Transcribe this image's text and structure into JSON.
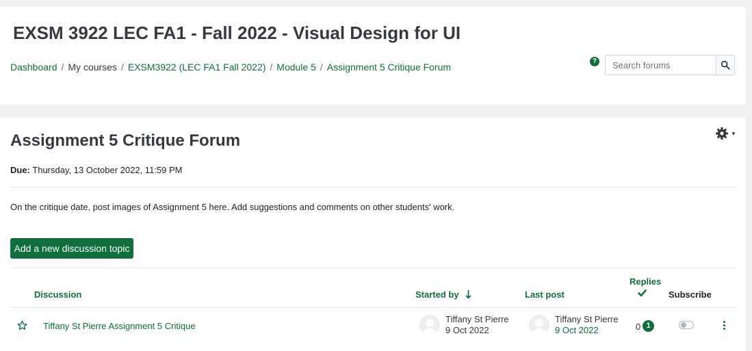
{
  "header": {
    "course_title": "EXSM 3922 LEC FA1 - Fall 2022 - Visual Design for UI",
    "breadcrumb": [
      {
        "label": "Dashboard",
        "link": true
      },
      {
        "label": "My courses",
        "link": false
      },
      {
        "label": "EXSM3922 (LEC FA1 Fall 2022)",
        "link": true
      },
      {
        "label": "Module 5",
        "link": true
      },
      {
        "label": "Assignment 5 Critique Forum",
        "link": true
      }
    ],
    "help_icon": "question-circle-icon",
    "search": {
      "placeholder": "Search forums",
      "value": ""
    }
  },
  "forum": {
    "title": "Assignment 5 Critique Forum",
    "due_label": "Due:",
    "due_value": "Thursday, 13 October 2022, 11:59 PM",
    "intro": "On the critique date, post images of Assignment 5 here. Add suggestions and comments on other students' work.",
    "add_topic_label": "Add a new discussion topic",
    "settings_icon": "gear-icon"
  },
  "table": {
    "columns": {
      "discussion": "Discussion",
      "started_by": "Started by",
      "last_post": "Last post",
      "replies": "Replies",
      "subscribe": "Subscribe"
    },
    "rows": [
      {
        "starred": false,
        "topic": "Tiffany St Pierre Assignment 5 Critique",
        "started_by_name": "Tiffany St Pierre",
        "started_by_date": "9 Oct 2022",
        "last_post_name": "Tiffany St Pierre",
        "last_post_date": "9 Oct 2022",
        "replies": "0",
        "unread": "1",
        "subscribed": false
      }
    ]
  },
  "colors": {
    "accent": "#0f6e3b",
    "page_bg": "#f2f2f2",
    "card_bg": "#ffffff"
  }
}
